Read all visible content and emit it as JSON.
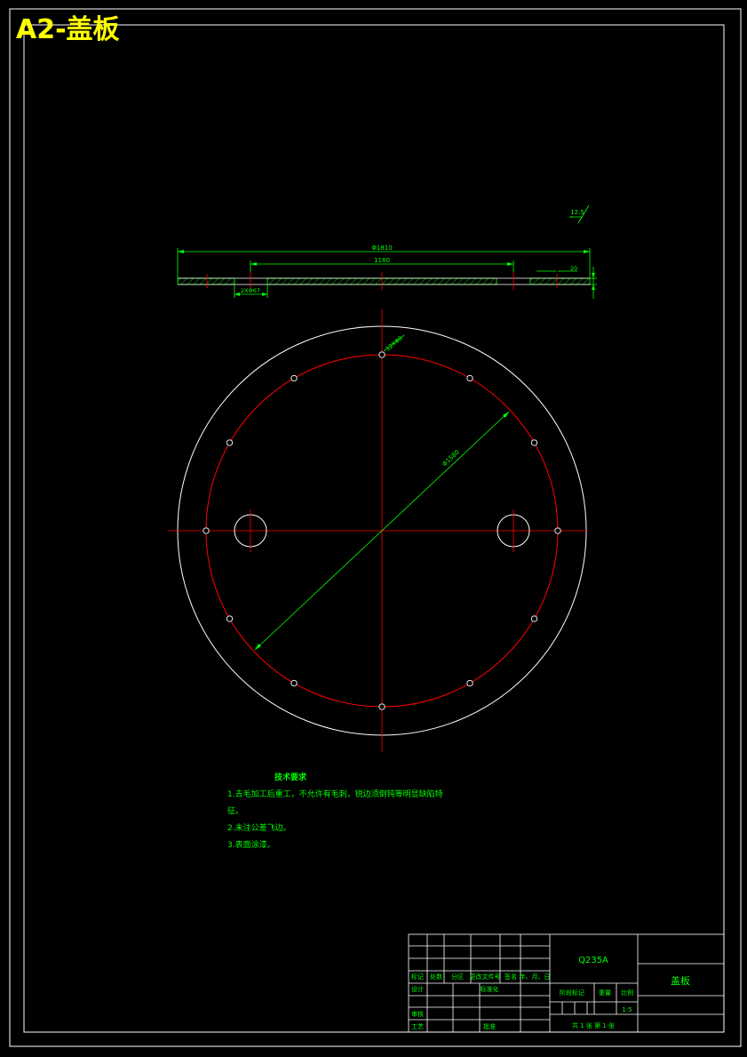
{
  "title": "A2-盖板",
  "dimensions": {
    "overall_width": "Φ1810",
    "bolt_spacing": "1180",
    "hole_callout": "2XΦ67",
    "thickness": "20",
    "roughness": "12.5",
    "hole_pattern": "12XΦ8",
    "bolt_circle": "Φ1580"
  },
  "technical_notes": {
    "heading": "技术要求",
    "items": [
      "1.去毛加工后重工，不允许有毛刺，锐边须倒钝等明显缺陷特",
      "征。",
      "2.未注公差飞边。",
      "3.表面涂漆。"
    ]
  },
  "title_block": {
    "material": "Q235A",
    "part_name": "盖板",
    "scale": "1:5",
    "header_row": [
      "标记",
      "处数",
      "分区",
      "更改文件号",
      "签名",
      "年、月、日"
    ],
    "designer_label": "设计",
    "standardization_label": "标准化",
    "stage_mark_label": "阶段标记",
    "weight_label": "重量",
    "scale_label": "比例",
    "review_label": "审核",
    "process_label": "工艺",
    "approve_label": "批准",
    "sheets": "共 1 张 第 1 张"
  },
  "colors": {
    "background": "#000000",
    "frame": "#ffffff",
    "dimension": "#00ff00",
    "centerline": "#ff0000",
    "title": "#ffff00"
  }
}
